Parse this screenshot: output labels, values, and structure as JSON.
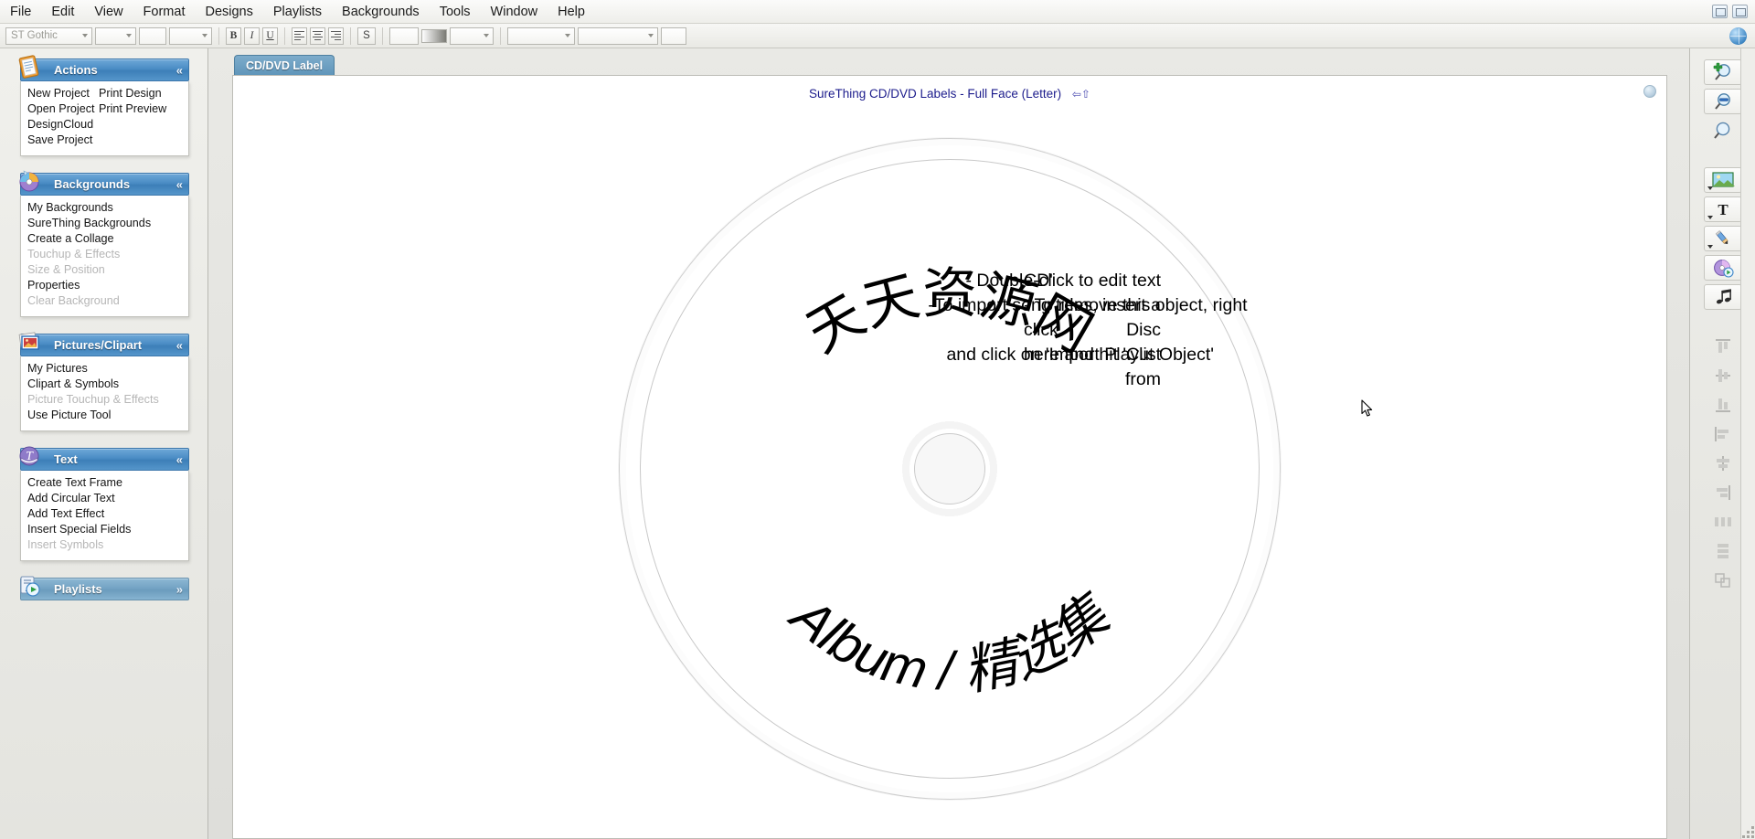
{
  "app": {
    "menu": [
      "File",
      "Edit",
      "View",
      "Format",
      "Designs",
      "Playlists",
      "Backgrounds",
      "Tools",
      "Window",
      "Help"
    ]
  },
  "toolbar": {
    "font_name": "ST Gothic",
    "font_size": "",
    "bold_label": "B",
    "italic_label": "I",
    "underline_label": "U",
    "shadow_label": "S",
    "align_left_name": "align-left",
    "align_center_name": "align-center",
    "align_right_name": "align-right",
    "globe_icon": "globe-icon"
  },
  "sidebar": {
    "panels": [
      {
        "id": "actions",
        "title": "Actions",
        "icon": "clipboard-icon",
        "collapsed": false,
        "chevron": "«",
        "layout": "two-col",
        "items": [
          {
            "label": "New Project",
            "enabled": true
          },
          {
            "label": "Print Design",
            "enabled": true
          },
          {
            "label": "Open Project",
            "enabled": true
          },
          {
            "label": "Print Preview",
            "enabled": true
          },
          {
            "label": "DesignCloud",
            "enabled": true
          },
          {
            "label": "",
            "enabled": true
          },
          {
            "label": "Save Project",
            "enabled": true
          },
          {
            "label": "",
            "enabled": true
          }
        ]
      },
      {
        "id": "backgrounds",
        "title": "Backgrounds",
        "icon": "palette-disc-icon",
        "collapsed": false,
        "chevron": "«",
        "layout": "one-col",
        "items": [
          {
            "label": "My Backgrounds",
            "enabled": true
          },
          {
            "label": "SureThing Backgrounds",
            "enabled": true
          },
          {
            "label": "Create a Collage",
            "enabled": true
          },
          {
            "label": "Touchup & Effects",
            "enabled": false
          },
          {
            "label": "Size & Position",
            "enabled": false
          },
          {
            "label": "Properties",
            "enabled": true
          },
          {
            "label": "Clear Background",
            "enabled": false
          }
        ]
      },
      {
        "id": "pictures-clipart",
        "title": "Pictures/Clipart",
        "icon": "photos-icon",
        "collapsed": false,
        "chevron": "«",
        "layout": "one-col",
        "items": [
          {
            "label": "My Pictures",
            "enabled": true
          },
          {
            "label": "Clipart & Symbols",
            "enabled": true
          },
          {
            "label": "Picture Touchup & Effects",
            "enabled": false
          },
          {
            "label": "Use Picture Tool",
            "enabled": true
          }
        ]
      },
      {
        "id": "text",
        "title": "Text",
        "icon": "text-tool-icon",
        "collapsed": false,
        "chevron": "«",
        "layout": "one-col",
        "items": [
          {
            "label": "Create Text Frame",
            "enabled": true
          },
          {
            "label": "Add Circular Text",
            "enabled": true
          },
          {
            "label": "Add Text Effect",
            "enabled": true
          },
          {
            "label": "Insert Special Fields",
            "enabled": true
          },
          {
            "label": "Insert Symbols",
            "enabled": false
          }
        ]
      },
      {
        "id": "playlists",
        "title": "Playlists",
        "icon": "playlist-icon",
        "collapsed": true,
        "chevron": "»",
        "layout": "one-col",
        "items": []
      }
    ]
  },
  "workarea": {
    "tab_label": "CD/DVD Label",
    "canvas_title": "SureThing CD/DVD Labels - Full Face  (Letter)",
    "canvas_title_icon": "swap-layout-icon",
    "corner_icon": "disc-preview-icon"
  },
  "label": {
    "arc_top_text": "天天资源网",
    "arc_bottom_text": "Album / 精选集",
    "left_block": [
      "- Double-click to edit text",
      "-To import song titles, insert a Disc",
      "and click on 'Import Playlist from"
    ],
    "right_block": [
      "CD'",
      "- To remove this object, right click",
      "here and hit 'Cut Object'"
    ]
  },
  "toolrail": {
    "tools": [
      {
        "name": "zoom-in-icon",
        "enabled": true,
        "group": 1
      },
      {
        "name": "zoom-out-icon",
        "enabled": true,
        "group": 1
      },
      {
        "name": "zoom-icon",
        "enabled": true,
        "group": 1
      },
      {
        "name": "picture-tool-icon",
        "enabled": true,
        "group": 2,
        "dropdown": true
      },
      {
        "name": "text-tool-icon",
        "enabled": true,
        "group": 2,
        "dropdown": true
      },
      {
        "name": "draw-tool-icon",
        "enabled": true,
        "group": 2,
        "dropdown": true
      },
      {
        "name": "disc-tool-icon",
        "enabled": true,
        "group": 2
      },
      {
        "name": "music-tool-icon",
        "enabled": true,
        "group": 2
      },
      {
        "name": "align-top-icon",
        "enabled": false,
        "group": 3
      },
      {
        "name": "align-middle-icon",
        "enabled": false,
        "group": 3
      },
      {
        "name": "align-bottom-icon",
        "enabled": false,
        "group": 3
      },
      {
        "name": "align-left-icon",
        "enabled": false,
        "group": 3
      },
      {
        "name": "align-center-icon",
        "enabled": false,
        "group": 3
      },
      {
        "name": "align-right-icon",
        "enabled": false,
        "group": 3
      },
      {
        "name": "distribute-h-icon",
        "enabled": false,
        "group": 3
      },
      {
        "name": "distribute-v-icon",
        "enabled": false,
        "group": 3
      },
      {
        "name": "group-objects-icon",
        "enabled": false,
        "group": 3
      }
    ]
  },
  "colors": {
    "panel_header_blue": "#4a8cc4",
    "tab_blue": "#5d93b8",
    "canvas_title_navy": "#1c1c8c",
    "window_bg": "#e8e8e4"
  }
}
